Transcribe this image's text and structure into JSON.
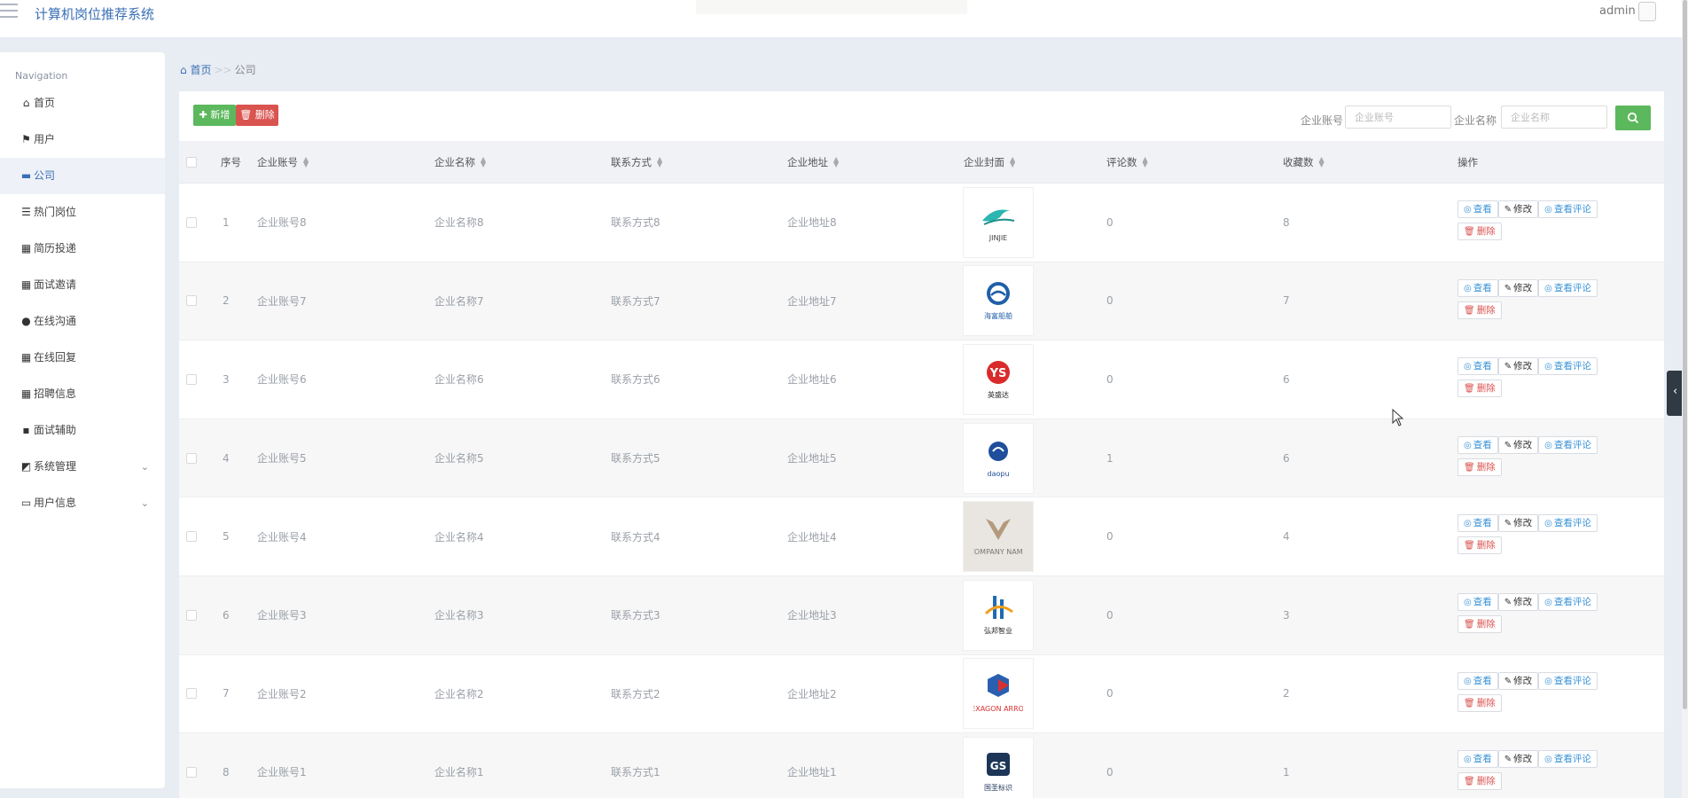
{
  "app": {
    "title": "计算机岗位推荐系统",
    "user": "admin"
  },
  "nav": {
    "caption": "Navigation",
    "items": [
      {
        "label": "首页",
        "icon": "home-icon"
      },
      {
        "label": "用户",
        "icon": "flag-icon"
      },
      {
        "label": "公司",
        "icon": "briefcase-icon"
      },
      {
        "label": "热门岗位",
        "icon": "list-icon"
      },
      {
        "label": "简历投递",
        "icon": "grid-icon"
      },
      {
        "label": "面试邀请",
        "icon": "grid-icon"
      },
      {
        "label": "在线沟通",
        "icon": "pin-icon"
      },
      {
        "label": "在线回复",
        "icon": "grid-icon"
      },
      {
        "label": "招聘信息",
        "icon": "grid-icon"
      },
      {
        "label": "面试辅助",
        "icon": "chat-icon"
      },
      {
        "label": "系统管理",
        "icon": "chart-icon"
      },
      {
        "label": "用户信息",
        "icon": "card-icon"
      }
    ],
    "active_index": 2
  },
  "breadcrumb": {
    "home": "首页",
    "sep": ">>",
    "current": "公司"
  },
  "toolbar": {
    "add_label": "新增",
    "delete_label": "删除"
  },
  "search": {
    "account_label": "企业账号",
    "account_placeholder": "企业账号",
    "name_label": "企业名称",
    "name_placeholder": "企业名称"
  },
  "table": {
    "headers": {
      "index": "序号",
      "account": "企业账号",
      "name": "企业名称",
      "contact": "联系方式",
      "address": "企业地址",
      "cover": "企业封面",
      "comments": "评论数",
      "favorites": "收藏数",
      "actions": "操作"
    },
    "actions": {
      "view": "查看",
      "edit": "修改",
      "comments": "查看评论",
      "delete": "删除"
    },
    "rows": [
      {
        "index": "1",
        "account": "企业账号8",
        "name": "企业名称8",
        "contact": "联系方式8",
        "address": "企业地址8",
        "comments": "0",
        "favorites": "8",
        "logo_text": "JINJIE"
      },
      {
        "index": "2",
        "account": "企业账号7",
        "name": "企业名称7",
        "contact": "联系方式7",
        "address": "企业地址7",
        "comments": "0",
        "favorites": "7",
        "logo_text": "海富船舶"
      },
      {
        "index": "3",
        "account": "企业账号6",
        "name": "企业名称6",
        "contact": "联系方式6",
        "address": "企业地址6",
        "comments": "0",
        "favorites": "6",
        "logo_text": "英盛达"
      },
      {
        "index": "4",
        "account": "企业账号5",
        "name": "企业名称5",
        "contact": "联系方式5",
        "address": "企业地址5",
        "comments": "1",
        "favorites": "6",
        "logo_text": "daopu"
      },
      {
        "index": "5",
        "account": "企业账号4",
        "name": "企业名称4",
        "contact": "联系方式4",
        "address": "企业地址4",
        "comments": "0",
        "favorites": "4",
        "logo_text": "COMPANY NAME"
      },
      {
        "index": "6",
        "account": "企业账号3",
        "name": "企业名称3",
        "contact": "联系方式3",
        "address": "企业地址3",
        "comments": "0",
        "favorites": "3",
        "logo_text": "弘邦智业"
      },
      {
        "index": "7",
        "account": "企业账号2",
        "name": "企业名称2",
        "contact": "联系方式2",
        "address": "企业地址2",
        "comments": "0",
        "favorites": "2",
        "logo_text": "HEXAGON ARROW"
      },
      {
        "index": "8",
        "account": "企业账号1",
        "name": "企业名称1",
        "contact": "联系方式1",
        "address": "企业地址1",
        "comments": "0",
        "favorites": "1",
        "logo_text": "国圣标识"
      }
    ]
  },
  "colors": {
    "accent": "#3a6fb5",
    "success": "#5cb85c",
    "danger": "#d9534f",
    "link": "#3a93d6"
  }
}
